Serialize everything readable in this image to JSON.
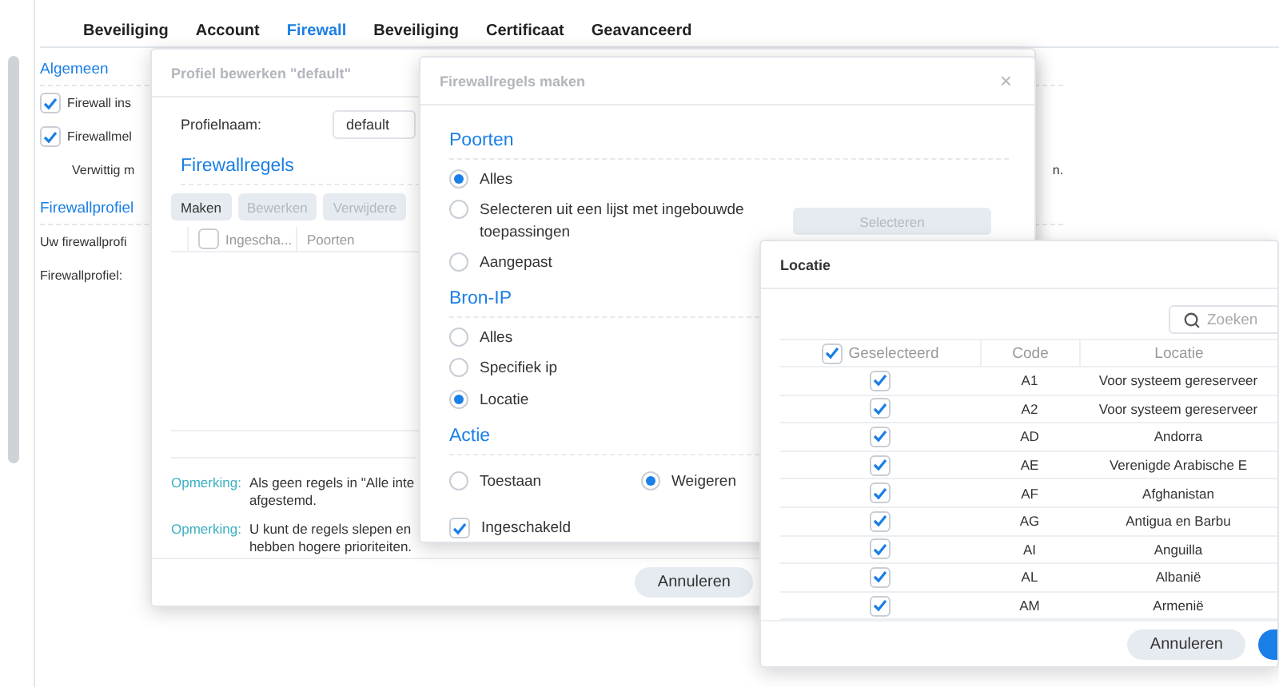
{
  "base": {
    "tabs": [
      {
        "label": "Beveiliging",
        "selected": false
      },
      {
        "label": "Account",
        "selected": false
      },
      {
        "label": "Firewall",
        "selected": true
      },
      {
        "label": "Beveiliging",
        "selected": false
      },
      {
        "label": "Certificaat",
        "selected": false
      },
      {
        "label": "Geavanceerd",
        "selected": false
      }
    ],
    "sections": [
      {
        "title": "Algemeen",
        "rows": [
          {
            "kind": "checkbox",
            "label": "Firewall ins",
            "checked": true
          },
          {
            "kind": "checkbox",
            "label": "Firewallmel",
            "checked": true
          },
          {
            "kind": "text",
            "label": "Verwittig m",
            "tail": "n."
          }
        ]
      },
      {
        "title": "Firewallprofiel",
        "rows": [
          {
            "kind": "text",
            "label": "Uw firewallprofi"
          },
          {
            "kind": "text",
            "label": "Firewallprofiel:"
          }
        ]
      }
    ]
  },
  "profile_dialog": {
    "title": "Profiel bewerken \"default\"",
    "name_label": "Profielnaam:",
    "name_value": "default",
    "rules_title": "Firewallregels",
    "toolbar": [
      {
        "label": "Maken",
        "disabled": false
      },
      {
        "label": "Bewerken",
        "disabled": true
      },
      {
        "label": "Verwijdere",
        "disabled": true
      }
    ],
    "columns": [
      {
        "label": "Ingescha...",
        "checked": false
      },
      {
        "label": "Poorten"
      }
    ],
    "notes": [
      {
        "label": "Opmerking:",
        "text": "Als geen regels in \"Alle inte",
        "text_2": "afgestemd."
      },
      {
        "label": "Opmerking:",
        "text": "U kunt de regels slepen en",
        "text_2": "hebben hogere prioriteiten."
      }
    ],
    "footer_button": "Annuleren"
  },
  "rule_dialog": {
    "title": "Firewallregels maken",
    "close": "×",
    "sections": [
      {
        "title": "Poorten",
        "options": [
          {
            "label": "Alles",
            "selected": true
          },
          {
            "label": "Selecteren uit een lijst met ingebouwde toepassingen",
            "selected": false,
            "button": "Selecteren"
          },
          {
            "label": "Aangepast",
            "selected": false
          }
        ]
      },
      {
        "title": "Bron-IP",
        "options": [
          {
            "label": "Alles",
            "selected": false
          },
          {
            "label": "Specifiek ip",
            "selected": false
          },
          {
            "label": "Locatie",
            "selected": true
          }
        ]
      }
    ],
    "action": {
      "title": "Actie",
      "options": [
        {
          "label": "Toestaan",
          "selected": false
        },
        {
          "label": "Weigeren",
          "selected": true
        }
      ]
    },
    "enabled": {
      "label": "Ingeschakeld",
      "checked": true
    }
  },
  "location_dialog": {
    "title": "Locatie",
    "search": {
      "placeholder": "Zoeken"
    },
    "columns": [
      {
        "label": "Geselecteerd",
        "checked": true
      },
      {
        "label": "Code"
      },
      {
        "label": "Locatie"
      }
    ],
    "rows": [
      {
        "checked": true,
        "code": "A1",
        "location": "Voor systeem gereserveer"
      },
      {
        "checked": true,
        "code": "A2",
        "location": "Voor systeem gereserveer"
      },
      {
        "checked": true,
        "code": "AD",
        "location": "Andorra"
      },
      {
        "checked": true,
        "code": "AE",
        "location": "Verenigde Arabische E"
      },
      {
        "checked": true,
        "code": "AF",
        "location": "Afghanistan"
      },
      {
        "checked": true,
        "code": "AG",
        "location": "Antigua en Barbu"
      },
      {
        "checked": true,
        "code": "AI",
        "location": "Anguilla"
      },
      {
        "checked": true,
        "code": "AL",
        "location": "Albanië"
      },
      {
        "checked": true,
        "code": "AM",
        "location": "Armenië"
      }
    ],
    "cancel": "Annuleren"
  }
}
